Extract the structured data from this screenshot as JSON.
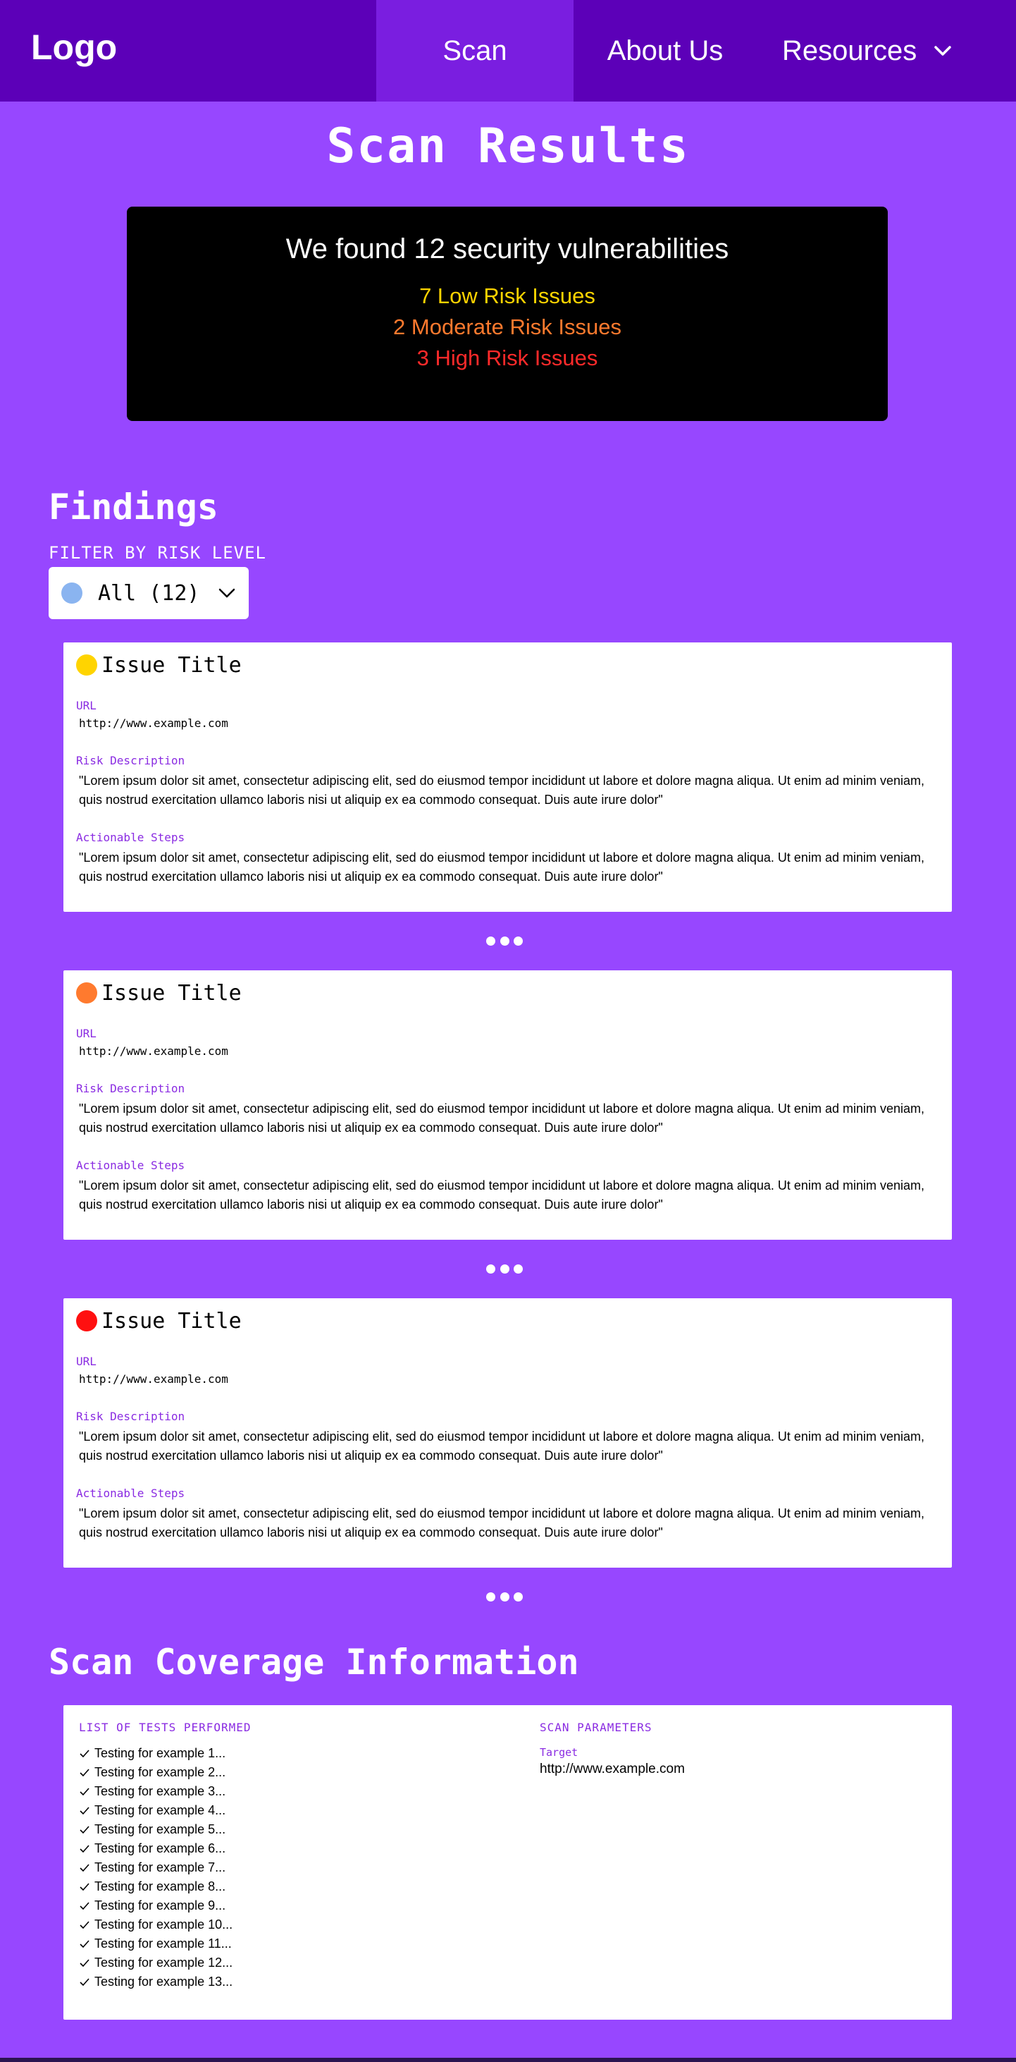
{
  "nav": {
    "logo": "Logo",
    "items": [
      {
        "label": "Scan",
        "active": true
      },
      {
        "label": "About Us",
        "active": false
      },
      {
        "label": "Resources",
        "active": false
      }
    ]
  },
  "page_title": "Scan Results",
  "summary": {
    "headline": "We found 12 security vulnerabilities",
    "low": "7 Low Risk Issues",
    "moderate": "2 Moderate Risk Issues",
    "high": "3 High Risk Issues"
  },
  "findings": {
    "title": "Findings",
    "filter_label": "FILTER BY RISK LEVEL",
    "filter_value": "All (12)",
    "url_label": "URL",
    "desc_label": "Risk Description",
    "steps_label": "Actionable Steps",
    "issues": [
      {
        "risk": "low",
        "title": "Issue Title",
        "url": "http://www.example.com",
        "description": "\"Lorem ipsum dolor sit amet, consectetur adipiscing elit, sed do eiusmod tempor incididunt ut labore et dolore magna aliqua. Ut enim ad minim veniam, quis nostrud exercitation ullamco laboris nisi ut aliquip ex ea commodo consequat. Duis aute irure dolor\"",
        "steps": "\"Lorem ipsum dolor sit amet, consectetur adipiscing elit, sed do eiusmod tempor incididunt ut labore et dolore magna aliqua. Ut enim ad minim veniam, quis nostrud exercitation ullamco laboris nisi ut aliquip ex ea commodo consequat. Duis aute irure dolor\""
      },
      {
        "risk": "moderate",
        "title": "Issue Title",
        "url": "http://www.example.com",
        "description": "\"Lorem ipsum dolor sit amet, consectetur adipiscing elit, sed do eiusmod tempor incididunt ut labore et dolore magna aliqua. Ut enim ad minim veniam, quis nostrud exercitation ullamco laboris nisi ut aliquip ex ea commodo consequat. Duis aute irure dolor\"",
        "steps": "\"Lorem ipsum dolor sit amet, consectetur adipiscing elit, sed do eiusmod tempor incididunt ut labore et dolore magna aliqua. Ut enim ad minim veniam, quis nostrud exercitation ullamco laboris nisi ut aliquip ex ea commodo consequat. Duis aute irure dolor\""
      },
      {
        "risk": "high",
        "title": "Issue Title",
        "url": "http://www.example.com",
        "description": "\"Lorem ipsum dolor sit amet, consectetur adipiscing elit, sed do eiusmod tempor incididunt ut labore et dolore magna aliqua. Ut enim ad minim veniam, quis nostrud exercitation ullamco laboris nisi ut aliquip ex ea commodo consequat. Duis aute irure dolor\"",
        "steps": "\"Lorem ipsum dolor sit amet, consectetur adipiscing elit, sed do eiusmod tempor incididunt ut labore et dolore magna aliqua. Ut enim ad minim veniam, quis nostrud exercitation ullamco laboris nisi ut aliquip ex ea commodo consequat. Duis aute irure dolor\""
      }
    ]
  },
  "coverage": {
    "title": "Scan Coverage Information",
    "tests_label": "LIST OF TESTS PERFORMED",
    "params_label": "SCAN PARAMETERS",
    "target_label": "Target",
    "target_value": "http://www.example.com",
    "tests": [
      "Testing for example 1...",
      "Testing for example 2...",
      "Testing for example 3...",
      "Testing for example 4...",
      "Testing for example 5...",
      "Testing for example 6...",
      "Testing for example 7...",
      "Testing for example 8...",
      "Testing for example 9...",
      "Testing for example 10...",
      "Testing for example 11...",
      "Testing for example 12...",
      "Testing for example 13..."
    ]
  },
  "colors": {
    "background": "#9747ff",
    "nav": "#5c00b8",
    "nav_active": "#7a1ee0",
    "low": "#ffd400",
    "moderate": "#ff7a2e",
    "high": "#ff1010",
    "label_purple": "#8a2be2"
  }
}
